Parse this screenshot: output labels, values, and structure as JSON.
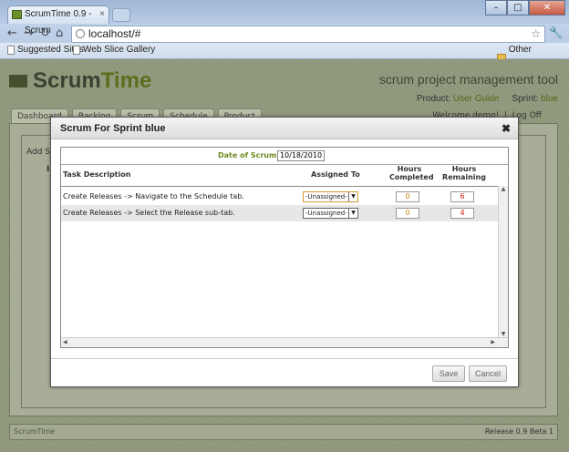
{
  "browser": {
    "tab_title": "ScrumTime 0.9 - Scrum",
    "tab_close": "×",
    "address": "localhost/#",
    "bookmarks": {
      "suggested": "Suggested Sites",
      "web_slice": "Web Slice Gallery",
      "other": "Other bookmarks"
    },
    "window_buttons": {
      "minimize": "–",
      "maximize": "□",
      "close": "✕"
    }
  },
  "app": {
    "logo_scrum": "Scrum",
    "logo_time": "Time",
    "tagline": "scrum project management tool",
    "product_label": "Product:",
    "product_value": "User Guide",
    "sprint_label": "Sprint:",
    "sprint_value": "blue",
    "tabs": [
      "Dashboard",
      "Backlog",
      "Scrum",
      "Schedule",
      "Product"
    ],
    "welcome": "Welcome demo!",
    "logoff": "Log Off",
    "add_scrum_partial": "Add Sc",
    "ind_partial": "Ind",
    "footer_left": "ScrumTime",
    "footer_right": "Release 0.9 Beta 1"
  },
  "modal": {
    "title": "Scrum For Sprint blue",
    "close": "✖",
    "date_label": "Date of Scrum:",
    "date_value": "10/18/2010",
    "columns": {
      "task": "Task Description",
      "assigned": "Assigned To",
      "hours_completed": [
        "Hours",
        "Completed"
      ],
      "hours_remaining": [
        "Hours",
        "Remaining"
      ]
    },
    "rows": [
      {
        "task": "Create Releases -> Navigate to the Schedule tab.",
        "assigned": "-Unassigned-",
        "completed": "0",
        "remaining": "6"
      },
      {
        "task": "Create Releases -> Select the Release sub-tab.",
        "assigned": "-Unassigned-",
        "completed": "0",
        "remaining": "4"
      }
    ],
    "save": "Save",
    "cancel": "Cancel"
  }
}
